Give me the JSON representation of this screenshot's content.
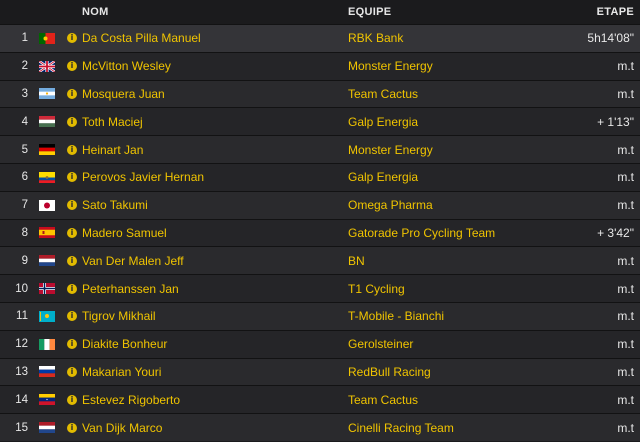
{
  "header": {
    "name": "NOM",
    "team": "EQUIPE",
    "stage": "ETAPE"
  },
  "colors": {
    "accent": "#f0c400",
    "background": "#1b1b1d"
  },
  "riders": [
    {
      "rank": "1",
      "flag": "portugal-flag",
      "name": "Da Costa Pilla Manuel",
      "team": "RBK Bank",
      "time": "5h14'08\""
    },
    {
      "rank": "2",
      "flag": "united-kingdom-flag",
      "name": "McVitton Wesley",
      "team": "Monster Energy",
      "time": "m.t"
    },
    {
      "rank": "3",
      "flag": "argentina-flag",
      "name": "Mosquera Juan",
      "team": "Team Cactus",
      "time": "m.t"
    },
    {
      "rank": "4",
      "flag": "hungary-flag",
      "name": "Toth Maciej",
      "team": "Galp Energia",
      "time": "+ 1'13\""
    },
    {
      "rank": "5",
      "flag": "germany-flag",
      "name": "Heinart Jan",
      "team": "Monster Energy",
      "time": "m.t"
    },
    {
      "rank": "6",
      "flag": "ecuador-flag",
      "name": "Perovos Javier Hernan",
      "team": "Galp Energia",
      "time": "m.t"
    },
    {
      "rank": "7",
      "flag": "japan-flag",
      "name": "Sato Takumi",
      "team": "Omega Pharma",
      "time": "m.t"
    },
    {
      "rank": "8",
      "flag": "spain-flag",
      "name": "Madero Samuel",
      "team": "Gatorade Pro Cycling Team",
      "time": "+ 3'42\""
    },
    {
      "rank": "9",
      "flag": "netherlands-flag",
      "name": "Van Der Malen Jeff",
      "team": "BN",
      "time": "m.t"
    },
    {
      "rank": "10",
      "flag": "norway-flag",
      "name": "Peterhanssen Jan",
      "team": "T1 Cycling",
      "time": "m.t"
    },
    {
      "rank": "11",
      "flag": "kazakhstan-flag",
      "name": "Tigrov Mikhail",
      "team": "T-Mobile - Bianchi",
      "time": "m.t"
    },
    {
      "rank": "12",
      "flag": "ireland-flag",
      "name": "Diakite Bonheur",
      "team": "Gerolsteiner",
      "time": "m.t"
    },
    {
      "rank": "13",
      "flag": "russia-flag",
      "name": "Makarian Youri",
      "team": "RedBull Racing",
      "time": "m.t"
    },
    {
      "rank": "14",
      "flag": "venezuela-flag",
      "name": "Estevez Rigoberto",
      "team": "Team Cactus",
      "time": "m.t"
    },
    {
      "rank": "15",
      "flag": "netherlands-flag",
      "name": "Van Dijk Marco",
      "team": "Cinelli Racing Team",
      "time": "m.t"
    }
  ]
}
